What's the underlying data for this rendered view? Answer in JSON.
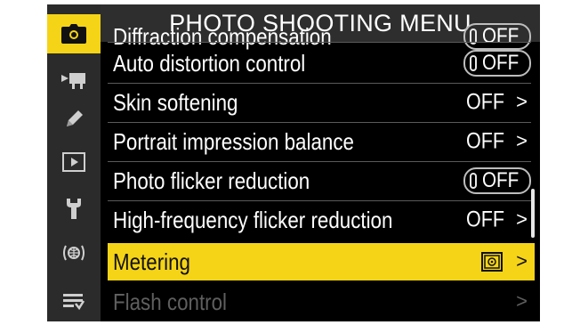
{
  "title": "PHOTO SHOOTING MENU",
  "tabs": [
    {
      "icon": "camera-icon",
      "active": true
    },
    {
      "icon": "movie-camera-icon",
      "active": false
    },
    {
      "icon": "pencil-icon",
      "active": false
    },
    {
      "icon": "playback-icon",
      "active": false
    },
    {
      "icon": "wrench-icon",
      "active": false
    },
    {
      "icon": "network-icon",
      "active": false
    },
    {
      "icon": "my-menu-icon",
      "active": false
    }
  ],
  "menu": {
    "partial_item": {
      "label": "Diffraction compensation",
      "value": "OFF"
    },
    "items": [
      {
        "label": "Auto distortion control",
        "value": "OFF",
        "control": "toggle"
      },
      {
        "label": "Skin softening",
        "value": "OFF",
        "control": "chevron"
      },
      {
        "label": "Portrait impression balance",
        "value": "OFF",
        "control": "chevron"
      },
      {
        "label": "Photo flicker reduction",
        "value": "OFF",
        "control": "toggle"
      },
      {
        "label": "High-frequency flicker reduction",
        "value": "OFF",
        "control": "chevron"
      },
      {
        "label": "Metering",
        "value_icon": "matrix-metering-icon",
        "control": "chevron",
        "selected": true
      },
      {
        "label": "Flash control",
        "control": "chevron",
        "disabled": true
      }
    ],
    "chevron": ">"
  },
  "colors": {
    "accent": "#f5d417",
    "background": "#000000",
    "tab_column": "#2b2b2b",
    "title_bar": "#2e2e2e"
  }
}
